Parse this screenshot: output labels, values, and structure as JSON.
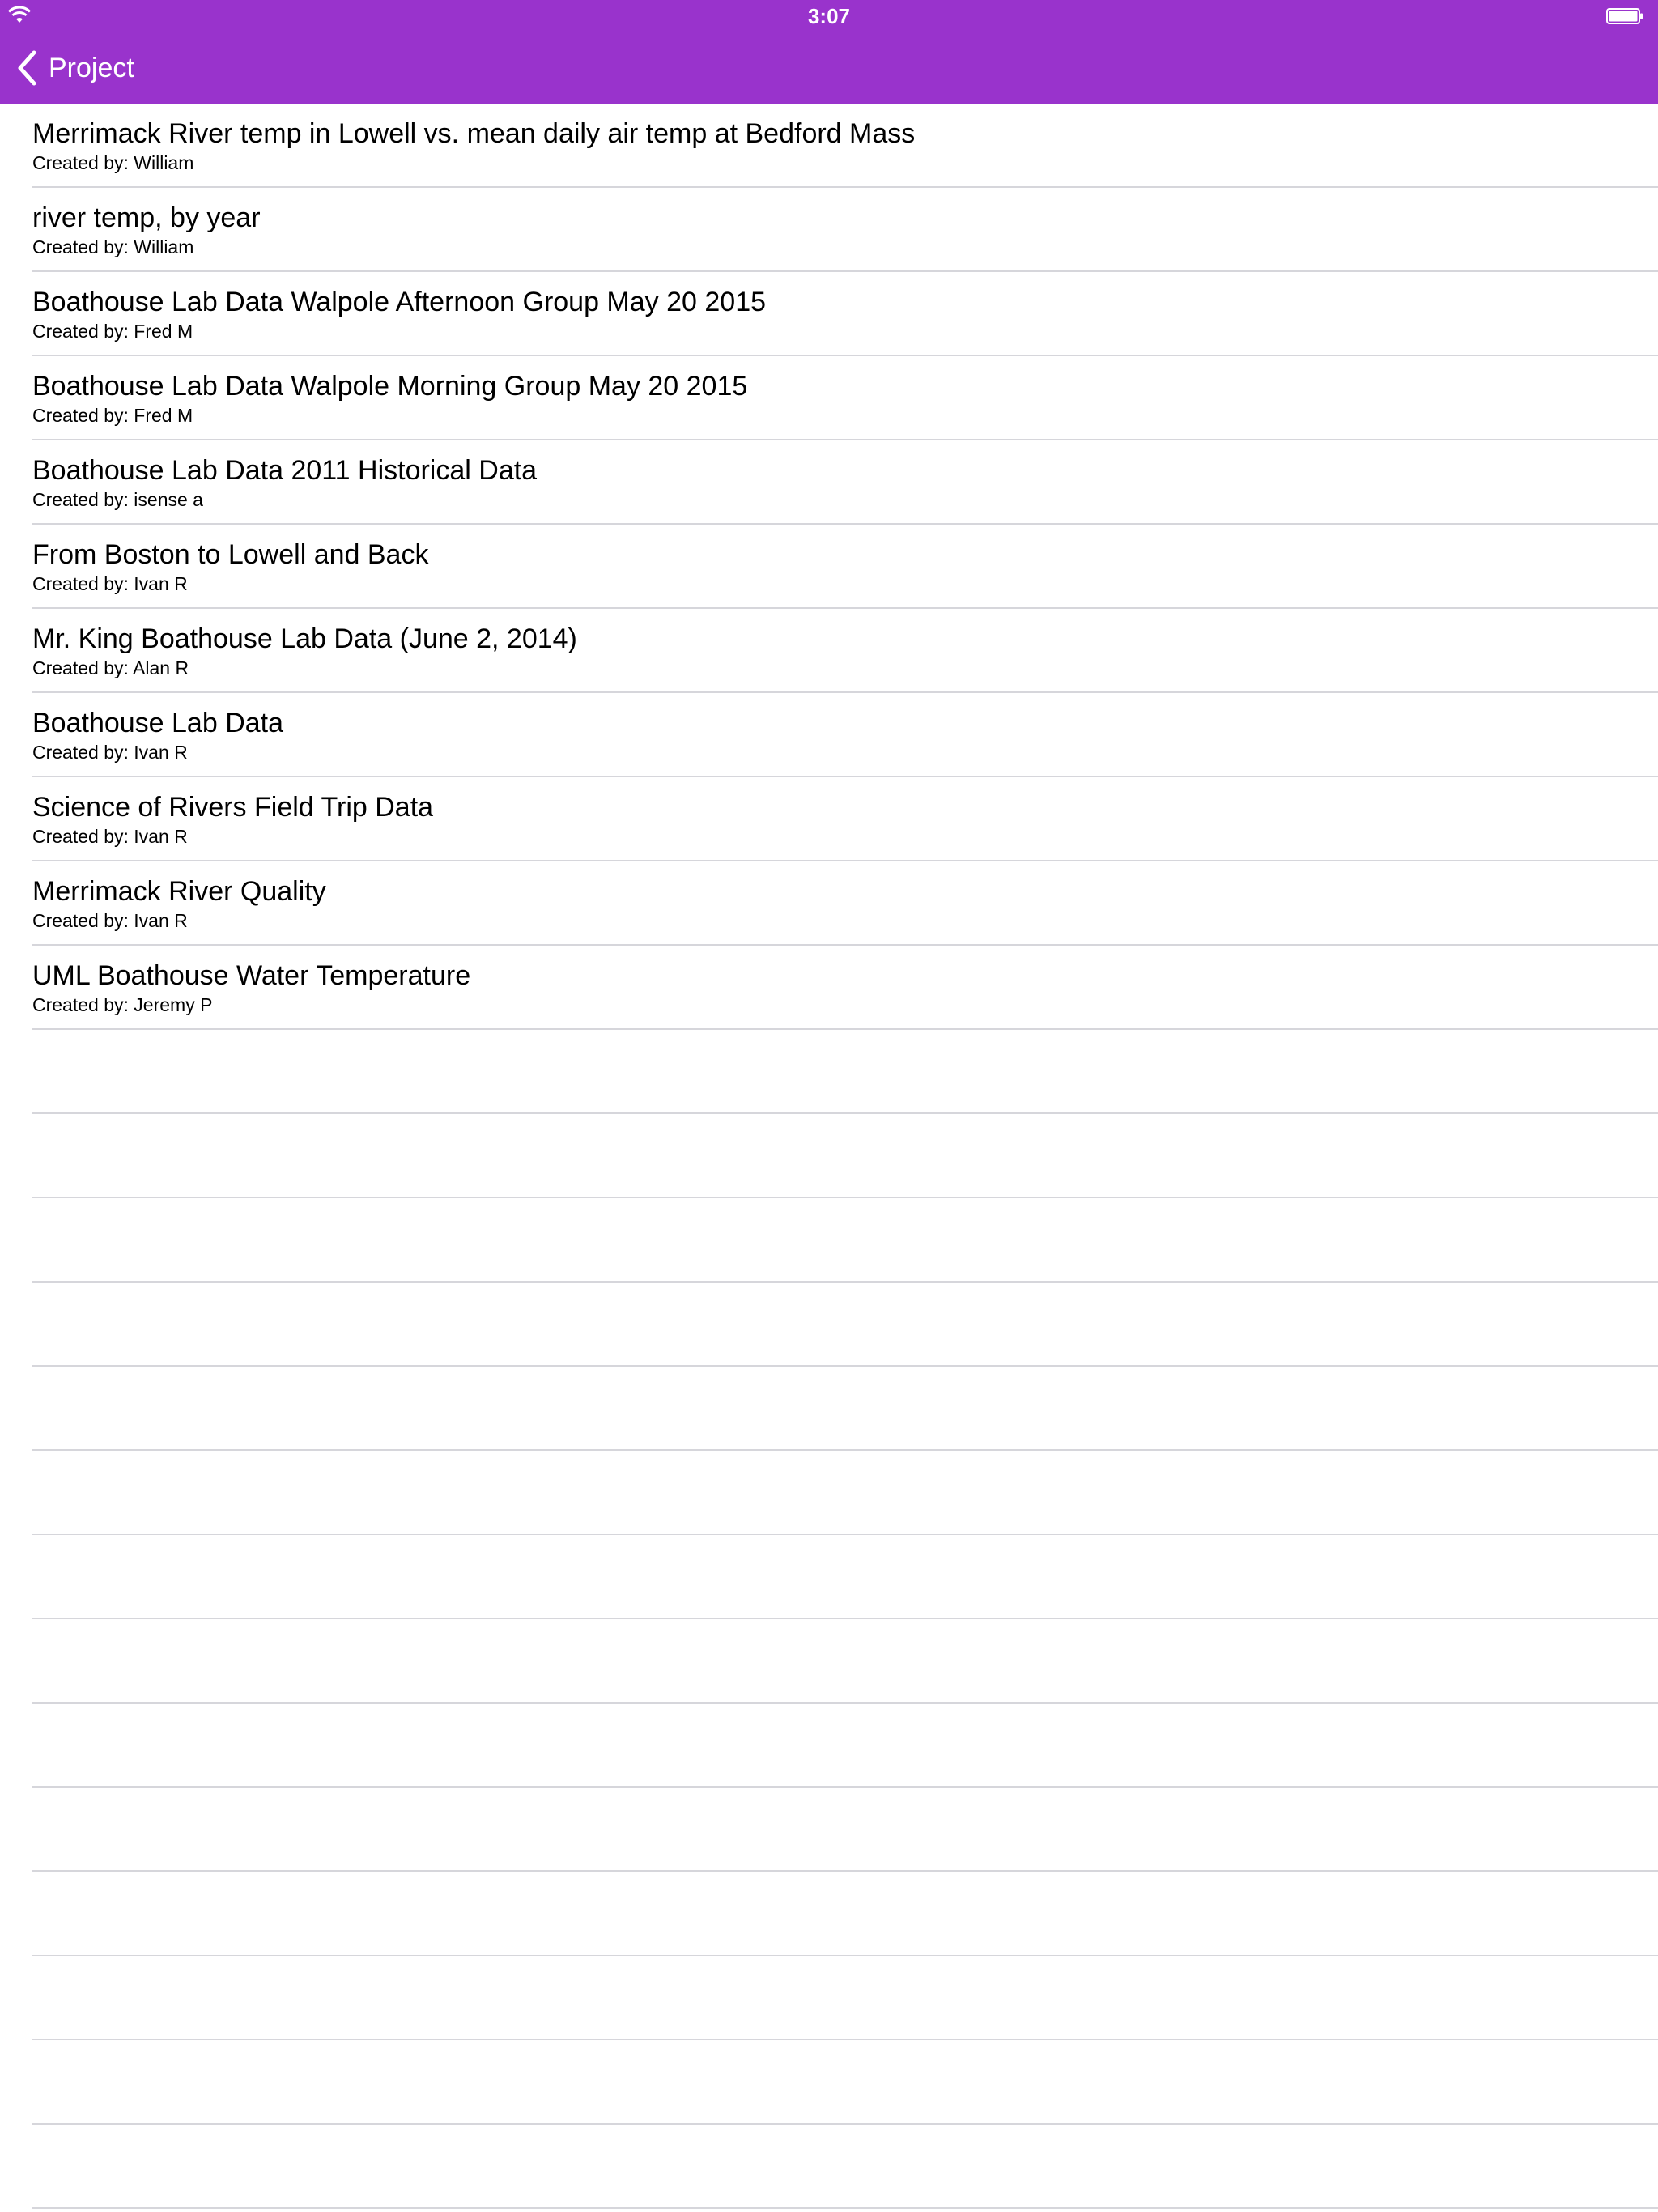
{
  "status_bar": {
    "time": "3:07",
    "wifi_icon": "wifi-icon",
    "battery_icon": "battery-icon"
  },
  "nav": {
    "back_label": "Project",
    "back_icon": "chevron-left-icon"
  },
  "colors": {
    "accent": "#9933cc",
    "separator": "#d6d6db"
  },
  "list": {
    "items": [
      {
        "title": "Merrimack River temp in Lowell vs. mean daily air temp at Bedford Mass",
        "subtitle": "Created by: William"
      },
      {
        "title": "river temp, by year",
        "subtitle": "Created by: William"
      },
      {
        "title": "Boathouse Lab Data Walpole Afternoon Group May 20 2015",
        "subtitle": "Created by: Fred M"
      },
      {
        "title": "Boathouse Lab Data Walpole Morning Group May 20 2015",
        "subtitle": "Created by: Fred M"
      },
      {
        "title": "Boathouse Lab Data 2011 Historical Data",
        "subtitle": "Created by: isense a"
      },
      {
        "title": "From Boston to Lowell and Back",
        "subtitle": "Created by: Ivan R"
      },
      {
        "title": "Mr. King Boathouse Lab Data (June 2, 2014)",
        "subtitle": "Created by: Alan R"
      },
      {
        "title": "Boathouse Lab Data",
        "subtitle": "Created by: Ivan R"
      },
      {
        "title": "Science of Rivers Field Trip Data",
        "subtitle": "Created by: Ivan R"
      },
      {
        "title": "Merrimack River Quality",
        "subtitle": "Created by: Ivan R"
      },
      {
        "title": "UML Boathouse Water Temperature",
        "subtitle": "Created by: Jeremy P"
      }
    ]
  }
}
